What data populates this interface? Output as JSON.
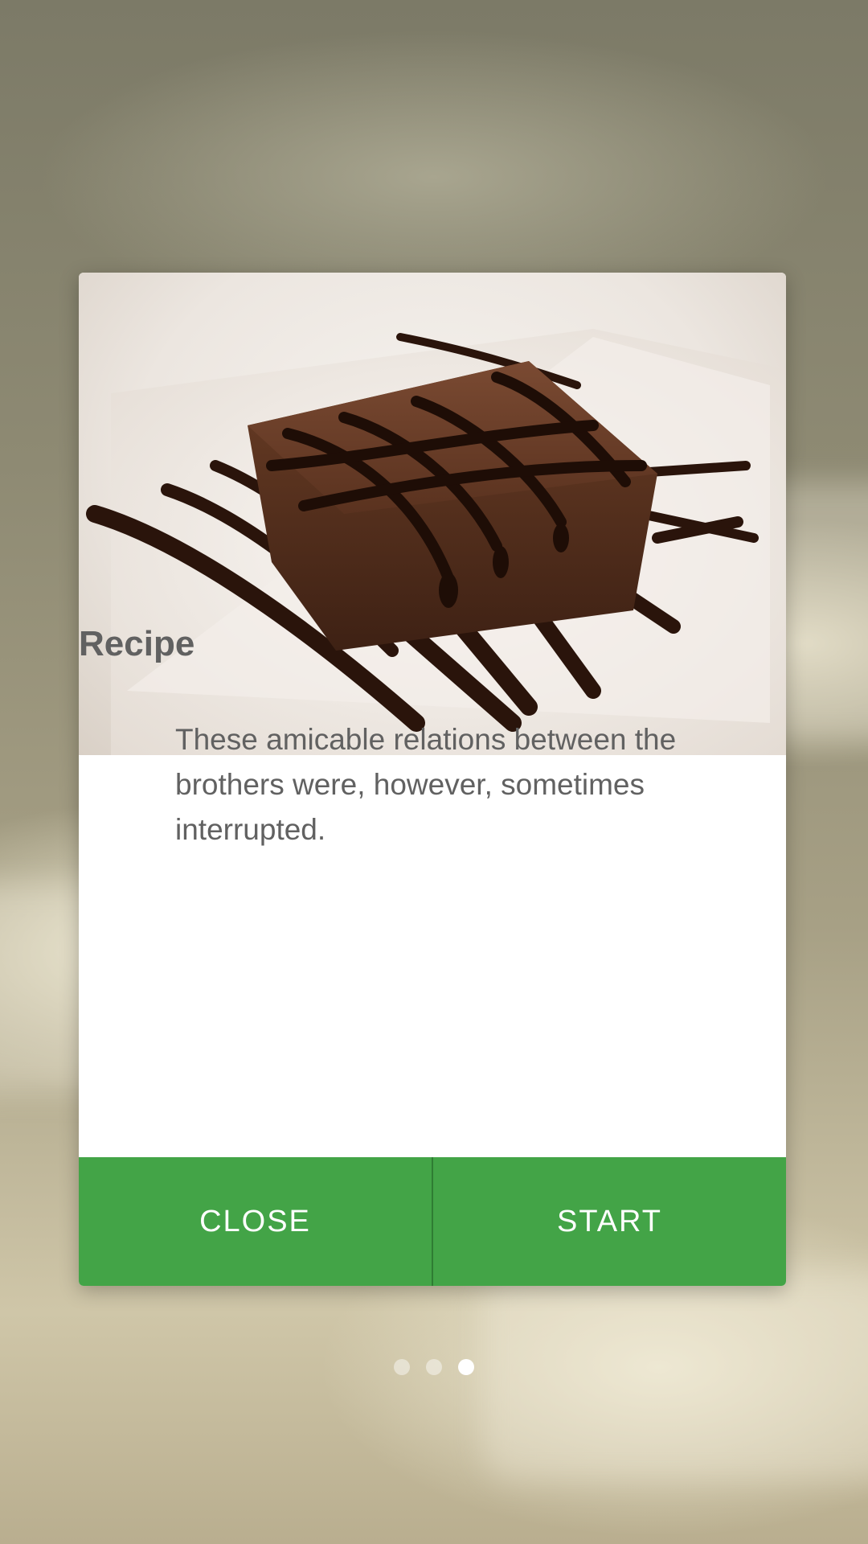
{
  "dialog": {
    "title": "Recipe",
    "description": "These amicable relations between the brothers were, however, sometimes interrupted.",
    "close_label": "CLOSE",
    "start_label": "START"
  },
  "pager": {
    "total": 3,
    "active_index": 2
  },
  "colors": {
    "button": "#43a447",
    "text": "#616161"
  },
  "icons": {
    "hero": "brownie-photo"
  }
}
